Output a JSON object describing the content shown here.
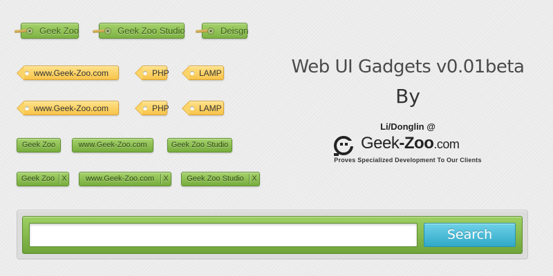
{
  "hang_tags": [
    "Geek Zoo",
    "Geek Zoo Studio",
    "Deisgn"
  ],
  "yellow_tags_row1": [
    "www.Geek-Zoo.com",
    "PHP",
    "LAMP"
  ],
  "yellow_tags_row2": [
    "www.Geek-Zoo.com",
    "PHP",
    "LAMP"
  ],
  "buttons": [
    "Geek Zoo",
    "www.Geek-Zoo.com",
    "Geek Zoo Studio"
  ],
  "closable_buttons": [
    "Geek Zoo",
    "www.Geek-Zoo.com",
    "Geek Zoo Studio"
  ],
  "close_glyph": "X",
  "title": "Web UI Gadgets v0.01beta",
  "by": "By",
  "author": "Li/Donglin @",
  "brand": {
    "part1": "Geek",
    "part2": "-Zoo",
    "part3": ".com"
  },
  "tagline": "Proves Specialized Development To Our Clients",
  "search": {
    "value": "",
    "placeholder": "",
    "button_label": "Search"
  },
  "colors": {
    "green_accent": "#8cc152",
    "yellow_accent": "#f7c44b",
    "search_button": "#3db3d2",
    "background": "#ececec"
  },
  "icons": {
    "brand_logo": "geek-zoo-logo-icon"
  }
}
